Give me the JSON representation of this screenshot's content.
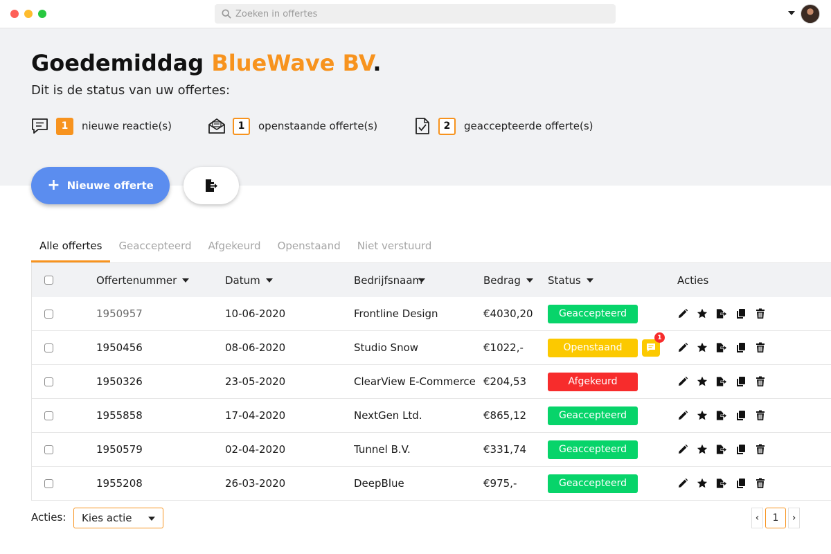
{
  "search": {
    "placeholder": "Zoeken in offertes"
  },
  "header": {
    "greeting": "Goedemiddag ",
    "company": "BlueWave BV",
    "period": ".",
    "subtitle": "Dit is de status van uw offertes:"
  },
  "stats": [
    {
      "icon": "chat-icon",
      "count": "1",
      "label": "nieuwe reactie(s)"
    },
    {
      "icon": "envelope-open-icon",
      "count": "1",
      "label": "openstaande offerte(s)"
    },
    {
      "icon": "document-check-icon",
      "count": "2",
      "label": "geaccepteerde offerte(s)"
    }
  ],
  "buttons": {
    "new_quote": "Nieuwe offerte",
    "export_icon": "file-export-icon"
  },
  "tabs": [
    "Alle offertes",
    "Geaccepteerd",
    "Afgekeurd",
    "Openstaand",
    "Niet verstuurd"
  ],
  "table": {
    "headers": {
      "number": "Offertenummer",
      "date": "Datum",
      "company": "Bedrijfsnaam",
      "amount": "Bedrag",
      "status": "Status",
      "actions": "Acties"
    },
    "rows": [
      {
        "number": "1950957",
        "date": "10-06-2020",
        "company": "Frontline Design",
        "amount": "€4030,20",
        "status": "Geaccepteerd"
      },
      {
        "number": "1950456",
        "date": "08-06-2020",
        "company": "Studio Snow",
        "amount": "€1022,-",
        "status": "Openstaand",
        "new_comments": "1"
      },
      {
        "number": "1950326",
        "date": "23-05-2020",
        "company": "ClearView E-Commerce",
        "amount": "€204,53",
        "status": "Afgekeurd"
      },
      {
        "number": "1955858",
        "date": "17-04-2020",
        "company": "NextGen Ltd.",
        "amount": "€865,12",
        "status": "Geaccepteerd"
      },
      {
        "number": "1950579",
        "date": "02-04-2020",
        "company": "Tunnel B.V.",
        "amount": "€331,74",
        "status": "Geaccepteerd"
      },
      {
        "number": "1955208",
        "date": "26-03-2020",
        "company": "DeepBlue",
        "amount": "€975,-",
        "status": "Geaccepteerd"
      }
    ]
  },
  "footer": {
    "actions_label": "Acties:",
    "select_value": "Kies actie",
    "pagination": {
      "prev": "‹",
      "current": "1",
      "next": "›"
    }
  },
  "colors": {
    "accent": "#f7931e",
    "primary": "#5b8def",
    "accepted": "#07d46a",
    "open": "#fcc900",
    "rejected": "#f72c2c"
  }
}
